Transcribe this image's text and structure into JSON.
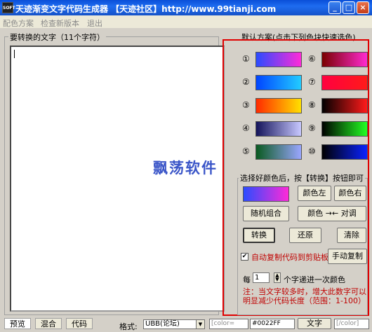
{
  "window": {
    "title": "天迹渐变文字代码生成器  【天迹社区】http://www.99tianji.com",
    "icon_text": "SOFT"
  },
  "menu": [
    "配色方案",
    "检查新版本",
    "退出"
  ],
  "left": {
    "legend": "要转换的文字（11个字符）",
    "text_value": ""
  },
  "right": {
    "legend": "默认方案(点击下列色块快速选色)",
    "presets": [
      {
        "num": "①",
        "from": "#2a4cff",
        "to": "#ff2ad8"
      },
      {
        "num": "②",
        "from": "#0044ff",
        "to": "#22ccff"
      },
      {
        "num": "③",
        "from": "#ff2a00",
        "to": "#ffe000"
      },
      {
        "num": "④",
        "from": "#14145a",
        "to": "#c8c8ff"
      },
      {
        "num": "⑤",
        "from": "#0a5a20",
        "to": "#9aa6ff"
      },
      {
        "num": "⑥",
        "from": "#7a0000",
        "to": "#ff2ad0"
      },
      {
        "num": "⑦",
        "from": "#ff0040",
        "to": "#ff1a1a"
      },
      {
        "num": "⑧",
        "from": "#000000",
        "to": "#ff1a1a"
      },
      {
        "num": "⑨",
        "from": "#000000",
        "to": "#22ff22"
      },
      {
        "num": "⑩",
        "from": "#000000",
        "to": "#0a22ff"
      }
    ],
    "instruction": "选择好颜色后，按【转换】按钮即可",
    "current_from": "#2a4cff",
    "current_to": "#ff2ad8",
    "btn_color_left": "颜色左",
    "btn_color_right": "颜色右",
    "btn_random": "随机组合",
    "btn_swap": "颜色 →← 对调",
    "btn_convert": "转换",
    "btn_restore": "还原",
    "btn_clear": "清除",
    "auto_copy_label": "自动复制代码到剪贴板",
    "auto_copy_checked": "✔",
    "btn_manual_copy": "手动复制",
    "step_prefix": "每",
    "step_value": "1",
    "step_suffix": "个字递进一次颜色",
    "note": "注：当文字较多时，增大此数字可以明显减少代码长度（范围：1-100）",
    "watermark": "飘荡软件"
  },
  "bottom": {
    "tabs": [
      "预览",
      "混合",
      "代码"
    ],
    "format_label": "格式:",
    "format_value": "UBB(论坛)",
    "tag_open": "[color=",
    "color_value": "#0022FF",
    "btn_text": "文字",
    "tag_close": "[/color]"
  },
  "colors": {
    "red_frame": "#e00000",
    "note_text": "#c00000"
  }
}
